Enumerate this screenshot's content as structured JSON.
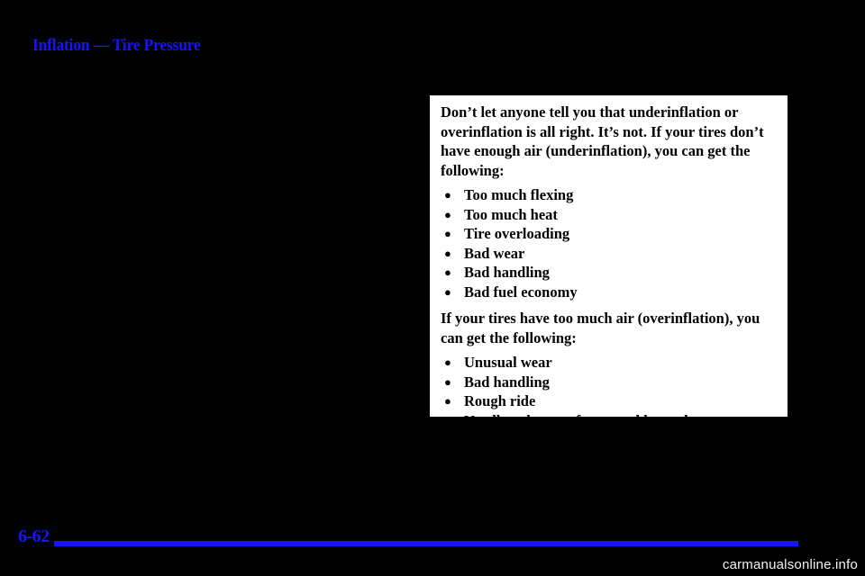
{
  "document": {
    "section_title": "Inflation — Tire Pressure",
    "page_number": "6-62",
    "title_color": "#1414ff",
    "background_color": "#000000",
    "page_color": "#ffffff"
  },
  "callout": {
    "intro_paragraph": "Don’t let anyone tell you that underinflation or overinflation is all right. It’s not. If your tires don’t have enough air (underinflation), you can get the following:",
    "under_items": [
      "Too much flexing",
      "Too much heat",
      "Tire overloading",
      "Bad wear",
      "Bad handling",
      "Bad fuel economy"
    ],
    "second_paragraph": "If your tires have too much air (overinflation), you can get the following:",
    "over_items": [
      "Unusual wear",
      "Bad handling",
      "Rough ride",
      "Needless damage from road hazards"
    ],
    "bullet_glyph": "●"
  },
  "watermark": {
    "text": "carmanualsonline.info"
  }
}
